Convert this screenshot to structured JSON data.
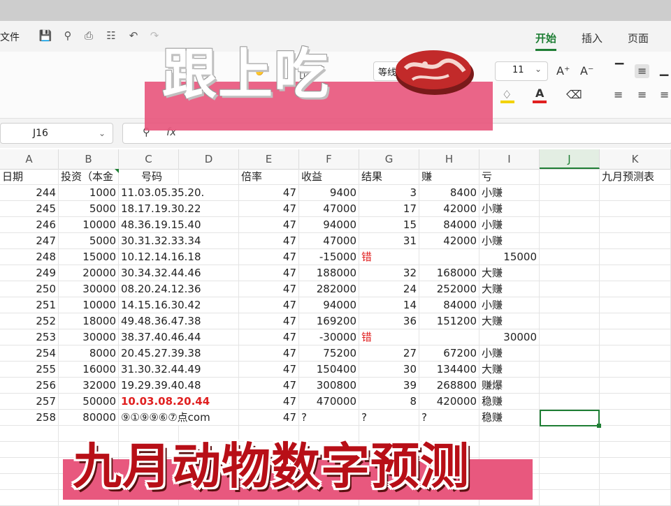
{
  "toolbar": {
    "file_menu": "文件",
    "tabs": [
      {
        "label": "开始",
        "active": true
      },
      {
        "label": "插入"
      },
      {
        "label": "页面"
      }
    ]
  },
  "ribbon": {
    "font_name_partial": "等线",
    "font_size": "11",
    "colors": {
      "fill_highlight": "#f2d200",
      "font_color": "#e02020"
    }
  },
  "formula_bar": {
    "cell_ref": "J16",
    "fx_label": "fx",
    "content": ""
  },
  "columns": [
    "A",
    "B",
    "C",
    "D",
    "E",
    "F",
    "G",
    "H",
    "I",
    "J",
    "K"
  ],
  "selected_column": "J",
  "headers": {
    "A": "日期",
    "B": "投资（本金",
    "C": "号码",
    "E": "倍率",
    "F": "收益",
    "G": "结果",
    "H": "赚",
    "I": "亏",
    "K": "九月预测表"
  },
  "rows": [
    {
      "date": "244",
      "invest": "1000",
      "number": "11.03.05.35.20.",
      "rate": "47",
      "income": "9400",
      "result": "3",
      "earn": "8400",
      "loss": "小赚"
    },
    {
      "date": "245",
      "invest": "5000",
      "number": "18.17.19.30.22",
      "rate": "47",
      "income": "47000",
      "result": "17",
      "earn": "42000",
      "loss": "小赚"
    },
    {
      "date": "246",
      "invest": "10000",
      "number": "48.36.19.15.40",
      "rate": "47",
      "income": "94000",
      "result": "15",
      "earn": "84000",
      "loss": "小赚"
    },
    {
      "date": "247",
      "invest": "5000",
      "number": "30.31.32.33.34",
      "rate": "47",
      "income": "47000",
      "result": "31",
      "earn": "42000",
      "loss": "小赚"
    },
    {
      "date": "248",
      "invest": "15000",
      "number": "10.12.14.16.18",
      "rate": "47",
      "income": "-15000",
      "result": "错",
      "earn": "",
      "loss": "15000"
    },
    {
      "date": "249",
      "invest": "20000",
      "number": "30.34.32.44.46",
      "rate": "47",
      "income": "188000",
      "result": "32",
      "earn": "168000",
      "loss": "大赚"
    },
    {
      "date": "250",
      "invest": "30000",
      "number": "08.20.24.12.36",
      "rate": "47",
      "income": "282000",
      "result": "24",
      "earn": "252000",
      "loss": "大赚"
    },
    {
      "date": "251",
      "invest": "10000",
      "number": "14.15.16.30.42",
      "rate": "47",
      "income": "94000",
      "result": "14",
      "earn": "84000",
      "loss": "小赚"
    },
    {
      "date": "252",
      "invest": "18000",
      "number": "49.48.36.47.38",
      "rate": "47",
      "income": "169200",
      "result": "36",
      "earn": "151200",
      "loss": "大赚"
    },
    {
      "date": "253",
      "invest": "30000",
      "number": "38.37.40.46.44",
      "rate": "47",
      "income": "-30000",
      "result": "错",
      "earn": "",
      "loss": "30000"
    },
    {
      "date": "254",
      "invest": "8000",
      "number": "20.45.27.39.38",
      "rate": "47",
      "income": "75200",
      "result": "27",
      "earn": "67200",
      "loss": "小赚"
    },
    {
      "date": "255",
      "invest": "16000",
      "number": "31.30.32.44.49",
      "rate": "47",
      "income": "150400",
      "result": "30",
      "earn": "134400",
      "loss": "大赚"
    },
    {
      "date": "256",
      "invest": "32000",
      "number": "19.29.39.40.48",
      "rate": "47",
      "income": "300800",
      "result": "39",
      "earn": "268800",
      "loss": "赚爆"
    },
    {
      "date": "257",
      "invest": "50000",
      "number": "10.03.08.20.44",
      "rate": "47",
      "income": "470000",
      "result": "8",
      "earn": "420000",
      "loss": "稳赚"
    },
    {
      "date": "258",
      "invest": "80000",
      "number": "⑨①⑨⑨⑥⑦点com",
      "rate": "47",
      "income": "?",
      "result": "?",
      "earn": "?",
      "loss": "稳赚"
    }
  ],
  "overlay": {
    "top_title": "跟上吃",
    "bottom_title": "九月动物数字预测",
    "banner_color": "#e8587e",
    "bottom_text_color": "#b80f17"
  }
}
